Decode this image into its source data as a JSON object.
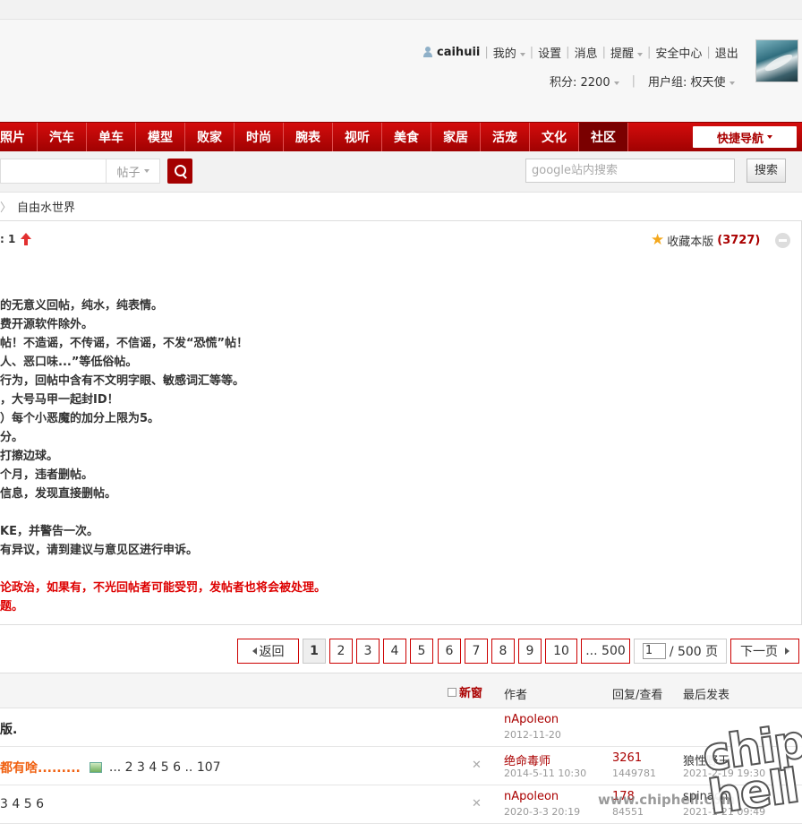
{
  "header": {
    "username": "caihuii",
    "links": [
      "我的",
      "设置",
      "消息",
      "提醒",
      "安全中心",
      "退出"
    ],
    "points_label": "积分: 2200",
    "group_label": "用户组: 权天使"
  },
  "nav": {
    "items": [
      "照片",
      "汽车",
      "单车",
      "模型",
      "败家",
      "时尚",
      "腕表",
      "视听",
      "美食",
      "家居",
      "活宠",
      "文化",
      "社区"
    ],
    "active": "社区",
    "quick_nav": "快捷导航"
  },
  "search": {
    "type_label": "帖子",
    "google_placeholder": "google站内搜索",
    "google_button": "搜索"
  },
  "breadcrumb": {
    "current": "自由水世界"
  },
  "forum": {
    "today_label": ": 1",
    "favorite_label": "收藏本版",
    "favorite_count": "(3727)",
    "rules": [
      {
        "text": "的无意义回帖，纯水，纯表情。",
        "red": false
      },
      {
        "text": "费开源软件除外。",
        "red": false
      },
      {
        "text": "帖！不造谣，不传谣，不信谣，不发“恐慌”帖！",
        "red": false
      },
      {
        "text": "人、恶口味...”等低俗帖。",
        "red": false
      },
      {
        "text": "行为，回帖中含有不文明字眼、敏感词汇等等。",
        "red": false
      },
      {
        "text": "，大号马甲一起封ID！",
        "red": false
      },
      {
        "text": "）每个小恶魔的加分上限为5。",
        "red": false
      },
      {
        "text": "分。",
        "red": false
      },
      {
        "text": "打擦边球。",
        "red": false
      },
      {
        "text": "个月，违者删帖。",
        "red": false
      },
      {
        "text": "信息，发现直接删帖。",
        "red": false
      },
      {
        "text": "KE，并警告一次。",
        "red": false
      },
      {
        "text": "有异议，请到建议与意见区进行申诉。",
        "red": false
      },
      {
        "text": "论政治，如果有，不光回帖者可能受罚，发帖者也将会被处理。",
        "red": true
      },
      {
        "text": "题。",
        "red": true
      }
    ]
  },
  "pager": {
    "back": "返回",
    "pages": [
      "1",
      "2",
      "3",
      "4",
      "5",
      "6",
      "7",
      "8",
      "9",
      "10"
    ],
    "current": "1",
    "last": "... 500",
    "input_value": "1",
    "total": "/ 500 页",
    "next": "下一页"
  },
  "thread_list": {
    "headers": {
      "new_window": "新窗",
      "author": "作者",
      "replies_views": "回复/查看",
      "last_post": "最后发表"
    },
    "rows": [
      {
        "title": "版.",
        "style": "bold",
        "pages": "",
        "has_img": false,
        "closable": false,
        "author": "nApoleon",
        "date": "2012-11-20",
        "replies": "",
        "views": "",
        "last_by": "",
        "last_date": ""
      },
      {
        "title": "都有啥.........",
        "style": "orange",
        "pages": "... 2 3 4 5 6 .. 107",
        "has_img": true,
        "closable": true,
        "author": "绝命毒师",
        "date": "2014-5-11 10:30",
        "replies": "3261",
        "views": "1449781",
        "last_by": "狼性野王",
        "last_date": "2021-2-19 19:30"
      },
      {
        "title": "3 4 5 6",
        "style": "normal",
        "pages": "",
        "has_img": false,
        "closable": true,
        "author": "nApoleon",
        "date": "2020-3-3 20:19",
        "replies": "178",
        "views": "84551",
        "last_by": "spinach",
        "last_date": "2021-1-21 09:49"
      }
    ]
  },
  "watermark": {
    "logo": "chip\nhell",
    "url": "www.chiphell.com"
  },
  "colors": {
    "brand_red": "#a00202",
    "nav_red": "#d40c0c",
    "orange_title": "#f06010"
  }
}
